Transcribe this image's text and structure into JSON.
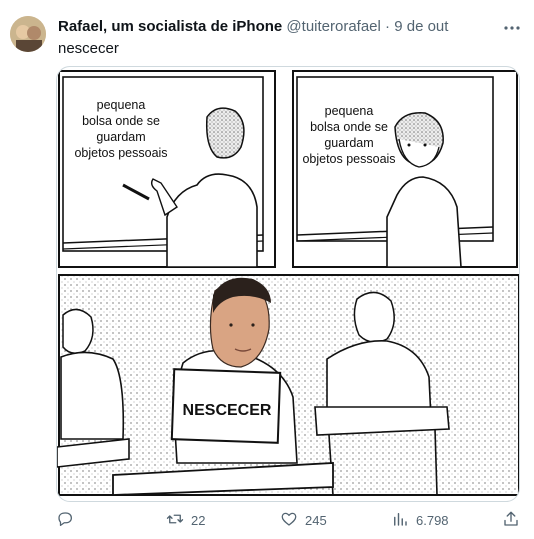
{
  "tweet": {
    "display_name": "Rafael, um socialista de iPhone",
    "handle": "@tuiterorafael",
    "separator": "·",
    "date": "9 de out",
    "text": "nescecer"
  },
  "meme": {
    "panel1_lines": [
      "pequena",
      "bolsa onde se",
      "guardam",
      "objetos pessoais"
    ],
    "panel2_lines": [
      "pequena",
      "bolsa onde se",
      "guardam",
      "objetos pessoais"
    ],
    "sign_text": "NESCECER"
  },
  "actions": {
    "reply_icon": "reply-icon",
    "retweet_icon": "retweet-icon",
    "retweet_count": "22",
    "like_icon": "heart-icon",
    "like_count": "245",
    "views_icon": "views-icon",
    "views_count": "6.798",
    "share_icon": "share-icon"
  },
  "colors": {
    "text_primary": "#0f1419",
    "text_secondary": "#536471",
    "border": "#cfd9de"
  }
}
